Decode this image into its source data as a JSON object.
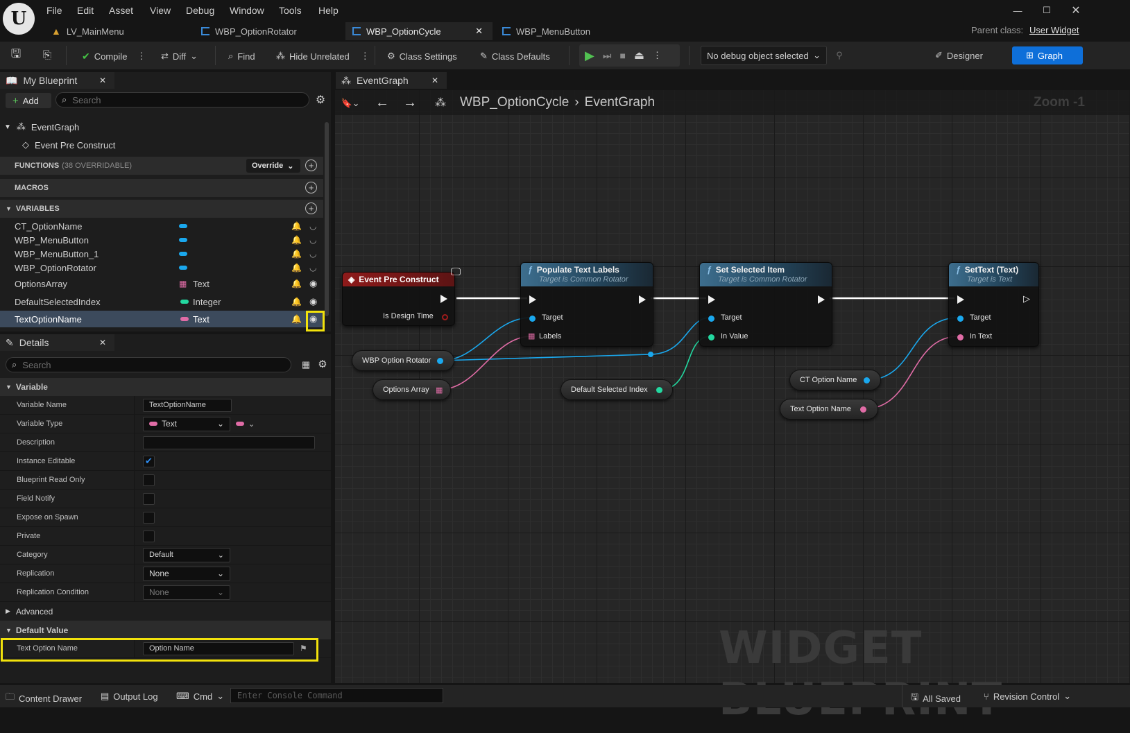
{
  "menu": [
    "File",
    "Edit",
    "Asset",
    "View",
    "Debug",
    "Window",
    "Tools",
    "Help"
  ],
  "doc_tabs": [
    {
      "label": "LV_MainMenu"
    },
    {
      "label": "WBP_OptionRotator"
    },
    {
      "label": "WBP_OptionCycle",
      "active": true
    },
    {
      "label": "WBP_MenuButton"
    }
  ],
  "parent_class": {
    "label": "Parent class:",
    "value": "User Widget"
  },
  "toolbar": {
    "compile": "Compile",
    "diff": "Diff",
    "find": "Find",
    "hide_unrelated": "Hide Unrelated",
    "class_settings": "Class Settings",
    "class_defaults": "Class Defaults",
    "debug_object": "No debug object selected",
    "designer": "Designer",
    "graph": "Graph"
  },
  "my_blueprint": {
    "tab_label": "My Blueprint",
    "add_label": "Add",
    "search_placeholder": "Search",
    "eventgraph": "EventGraph",
    "event_pre_construct": "Event Pre Construct",
    "functions_label": "FUNCTIONS",
    "functions_count": "(38 OVERRIDABLE)",
    "override_label": "Override",
    "macros_label": "MACROS",
    "variables_label": "VARIABLES",
    "variables": [
      {
        "name": "CT_OptionName",
        "type": "",
        "color": "#1aa8ee"
      },
      {
        "name": "WBP_MenuButton",
        "type": "",
        "color": "#1aa8ee"
      },
      {
        "name": "WBP_MenuButton_1",
        "type": "",
        "color": "#1aa8ee"
      },
      {
        "name": "WBP_OptionRotator",
        "type": "",
        "color": "#1aa8ee"
      },
      {
        "name": "OptionsArray",
        "type": "Text",
        "color": "#e06ca6"
      },
      {
        "name": "DefaultSelectedIndex",
        "type": "Integer",
        "color": "#23d8a0"
      },
      {
        "name": "TextOptionName",
        "type": "Text",
        "color": "#e06ca6"
      }
    ]
  },
  "details": {
    "tab_label": "Details",
    "search_placeholder": "Search",
    "variable_section": "Variable",
    "rows": [
      {
        "label": "Variable Name",
        "value": "TextOptionName"
      },
      {
        "label": "Variable Type",
        "value": "Text"
      },
      {
        "label": "Description",
        "value": ""
      },
      {
        "label": "Instance Editable",
        "value": ""
      },
      {
        "label": "Blueprint Read Only",
        "value": ""
      },
      {
        "label": "Field Notify",
        "value": ""
      },
      {
        "label": "Expose on Spawn",
        "value": ""
      },
      {
        "label": "Private",
        "value": ""
      },
      {
        "label": "Category",
        "value": "Default"
      },
      {
        "label": "Replication",
        "value": "None"
      },
      {
        "label": "Replication Condition",
        "value": "None"
      }
    ],
    "advanced": "Advanced",
    "default_value_section": "Default Value",
    "default_row": {
      "label": "Text Option Name",
      "value": "Option Name"
    }
  },
  "graph": {
    "tab_label": "EventGraph",
    "breadcrumb_root": "WBP_OptionCycle",
    "breadcrumb_leaf": "EventGraph",
    "zoom": "Zoom -1",
    "watermark": "WIDGET BLUEPRINT",
    "nodes": {
      "event": {
        "title": "Event Pre Construct",
        "pin": "Is Design Time"
      },
      "populate": {
        "title": "Populate Text Labels",
        "subtitle": "Target is Common Rotator",
        "pin1": "Target",
        "pin2": "Labels"
      },
      "setsel": {
        "title": "Set Selected Item",
        "subtitle": "Target is Common Rotator",
        "pin1": "Target",
        "pin2": "In Value"
      },
      "settext": {
        "title": "SetText (Text)",
        "subtitle": "Target is Text",
        "pin1": "Target",
        "pin2": "In Text"
      },
      "v_rotator": "WBP Option Rotator",
      "v_array": "Options Array",
      "v_default": "Default Selected Index",
      "v_ct": "CT Option Name",
      "v_text": "Text Option Name"
    }
  },
  "bottom": {
    "content_drawer": "Content Drawer",
    "output_log": "Output Log",
    "cmd": "Cmd",
    "console_placeholder": "Enter Console Command",
    "all_saved": "All Saved",
    "revision_control": "Revision Control"
  },
  "colors": {
    "accent": "#0e6fd9",
    "highlight": "#f2e20c",
    "text_pin": "#e06ca6",
    "object_pin": "#1aa8ee",
    "int_pin": "#23d8a0"
  }
}
